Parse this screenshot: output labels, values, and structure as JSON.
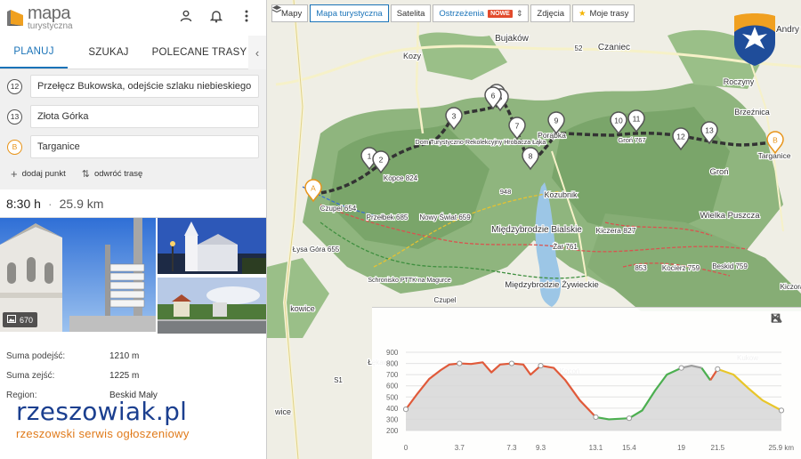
{
  "app": {
    "logo_main": "mapa",
    "logo_sub": "turystyczna"
  },
  "tabs": [
    {
      "label": "PLANUJ",
      "active": true
    },
    {
      "label": "SZUKAJ",
      "active": false
    },
    {
      "label": "POLECANE TRASY",
      "active": false
    }
  ],
  "route_points": [
    {
      "badge": "12",
      "value": "Przełęcz Bukowska, odejście szlaku niebieskiego"
    },
    {
      "badge": "13",
      "value": "Złota Górka"
    },
    {
      "badge": "B",
      "value": "Targanice"
    }
  ],
  "actions": {
    "add_point": "dodaj punkt",
    "reverse": "odwróć trasę"
  },
  "summary": {
    "time": "8:30 h",
    "separator": "·",
    "distance": "25.9 km"
  },
  "photos": {
    "count": "670"
  },
  "info": [
    {
      "label": "Suma podejść:",
      "value": "1210 m"
    },
    {
      "label": "Suma zejść:",
      "value": "1225 m"
    },
    {
      "label": "Region:",
      "value": "Beskid Mały"
    }
  ],
  "watermark": {
    "main": "rzeszowiak.pl",
    "sub": "rzeszowski serwis ogłoszeniowy"
  },
  "map_toolbar": {
    "maps": "Mapy",
    "tourist": "Mapa turystyczna",
    "satellite": "Satelita",
    "warnings": "Ostrzeżenia",
    "new_badge": "NOWE",
    "photos": "Zdjęcia",
    "my_routes": "Moje trasy"
  },
  "map_labels": [
    {
      "text": "Bujaków"
    },
    {
      "text": "Czaniec"
    },
    {
      "text": "Kozy"
    },
    {
      "text": "Roczyny"
    },
    {
      "text": "Brzeźnica"
    },
    {
      "text": "Kozubnik"
    },
    {
      "text": "Międzybrodzie Bialskie"
    },
    {
      "text": "Wielka Puszcza"
    },
    {
      "text": "Kiczera 827"
    },
    {
      "text": "Międzybrodzie Żywieckie"
    },
    {
      "text": "Groń"
    },
    {
      "text": "Targanice"
    },
    {
      "text": "Nowy Świat 659"
    },
    {
      "text": "Kopce 824"
    },
    {
      "text": "Przełbek 685"
    },
    {
      "text": "Czupel 654"
    },
    {
      "text": "Łysa Góra 655"
    },
    {
      "text": "Schronisko PTTK na Magurce"
    },
    {
      "text": "Dom Turystyczno-Rekolekcyjny Hrobacza Łąka"
    },
    {
      "text": "Porąbka"
    },
    {
      "text": "Łysa Góra"
    },
    {
      "text": "Kocierz 759"
    },
    {
      "text": "Beskid 759"
    },
    {
      "text": "853"
    },
    {
      "text": "Żar 761"
    },
    {
      "text": "Kiczora"
    },
    {
      "text": "Czupel"
    },
    {
      "text": "Łękawica"
    },
    {
      "text": "Kocoń"
    },
    {
      "text": "Kukow"
    },
    {
      "text": "Groń 767"
    },
    {
      "text": "Andry"
    },
    {
      "text": "S1"
    },
    {
      "text": "52"
    },
    {
      "text": "948"
    },
    {
      "text": "wice"
    },
    {
      "text": "kowice"
    }
  ],
  "waypoints": [
    "A",
    "1",
    "2",
    "3",
    "4",
    "5",
    "6",
    "7",
    "8",
    "9",
    "10",
    "11",
    "12",
    "13",
    "B"
  ],
  "chart_data": {
    "type": "area",
    "title": "",
    "xlabel": "",
    "ylabel": "",
    "x_ticks": [
      "0",
      "3.7",
      "7.3",
      "9.3",
      "13.1",
      "15.4",
      "19",
      "21.5",
      "25.9 km"
    ],
    "y_ticks": [
      "900",
      "800",
      "700",
      "600",
      "500",
      "400",
      "300",
      "200"
    ],
    "ylim": [
      200,
      900
    ],
    "xlim": [
      0,
      25.9
    ],
    "series": [
      {
        "color": "#e05a3a",
        "x": [
          0,
          0.8,
          1.6,
          2.4,
          3.0,
          3.7,
          4.5,
          5.3,
          5.9,
          6.5,
          7.3,
          8.1,
          8.6,
          9.3,
          10.2,
          11.0,
          12.0,
          13.1
        ],
        "y": [
          390,
          530,
          660,
          740,
          790,
          800,
          795,
          810,
          720,
          790,
          800,
          790,
          700,
          780,
          760,
          650,
          470,
          320
        ]
      },
      {
        "color": "#4caf50",
        "x": [
          13.1,
          14.0,
          15.4,
          16.3,
          17.2,
          18.0,
          19.0
        ],
        "y": [
          320,
          300,
          310,
          380,
          560,
          700,
          760
        ]
      },
      {
        "color": "#9e9e9e",
        "x": [
          19.0,
          19.7,
          20.4
        ],
        "y": [
          760,
          780,
          760
        ]
      },
      {
        "color": "#4caf50",
        "x": [
          20.4,
          21.0
        ],
        "y": [
          760,
          650
        ]
      },
      {
        "color": "#e05a3a",
        "x": [
          21.0,
          21.5
        ],
        "y": [
          650,
          750
        ]
      },
      {
        "color": "#e8c62a",
        "x": [
          21.5,
          22.6,
          23.6,
          24.6,
          25.9
        ],
        "y": [
          750,
          700,
          580,
          470,
          380
        ]
      }
    ],
    "markers_x": [
      0,
      3.7,
      7.3,
      9.3,
      13.1,
      15.4,
      19.0,
      21.5,
      25.9
    ],
    "grid": true,
    "colors": {
      "climb_hard": "#e05a3a",
      "easy": "#4caf50",
      "flat": "#9e9e9e",
      "medium": "#e8c62a"
    }
  },
  "colors": {
    "accent": "#1a73b8",
    "route_marker": "#e8941a",
    "forest": "#7aa56a",
    "water": "#9cc6e6"
  }
}
